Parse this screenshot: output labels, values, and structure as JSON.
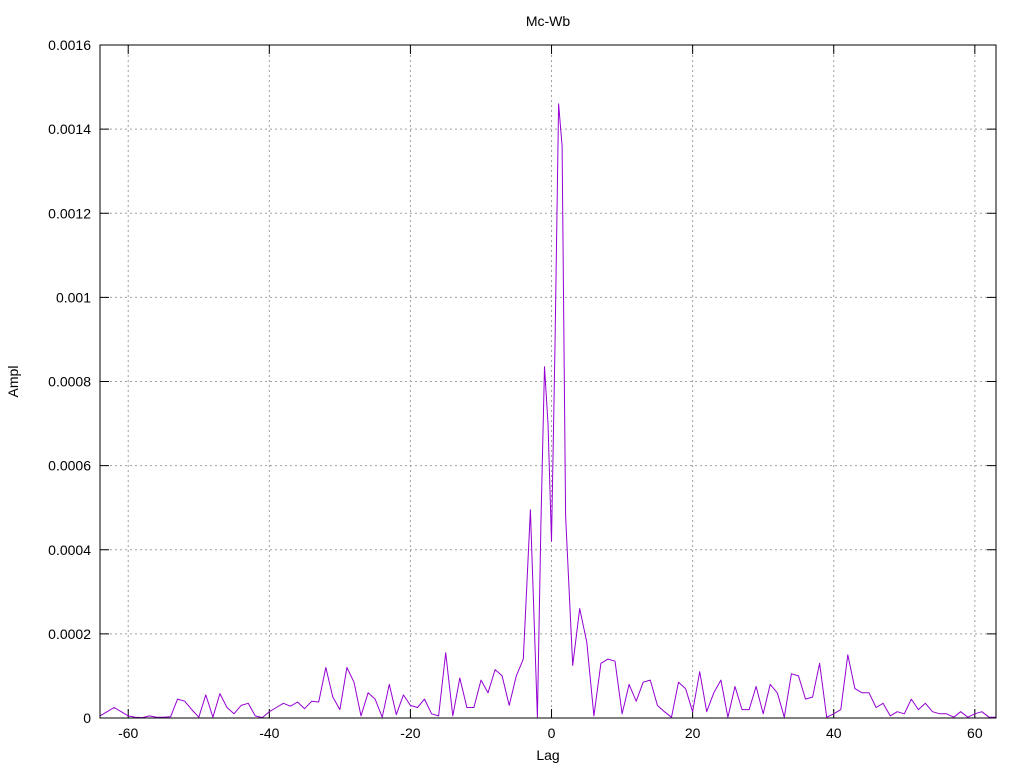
{
  "chart_data": {
    "type": "line",
    "title": "Mc-Wb",
    "xlabel": "Lag",
    "ylabel": "Ampl",
    "xlim": [
      -64,
      63
    ],
    "ylim": [
      0,
      0.0016
    ],
    "grid": true,
    "x_ticks": [
      -60,
      -40,
      -20,
      0,
      20,
      40,
      60
    ],
    "x_tick_labels": [
      "-60",
      "-40",
      "-20",
      "0",
      "20",
      "40",
      "60"
    ],
    "y_ticks": [
      0,
      0.0002,
      0.0004,
      0.0006,
      0.0008,
      0.001,
      0.0012,
      0.0014,
      0.0016
    ],
    "y_tick_labels": [
      "0",
      "0.0002",
      "0.0004",
      "0.0006",
      "0.0008",
      "0.001",
      "0.0012",
      "0.0014",
      "0.0016"
    ],
    "line_color": "#9400d3",
    "series": [
      {
        "x": [
          -64,
          -63,
          -62,
          -61,
          -60,
          -59,
          -58,
          -57,
          -56,
          -55,
          -54,
          -53,
          -52,
          -51,
          -50,
          -49,
          -48,
          -47,
          -46,
          -45,
          -44,
          -43,
          -42,
          -41,
          -40,
          -39,
          -38,
          -37,
          -36,
          -35,
          -34,
          -33,
          -32,
          -31,
          -30,
          -29,
          -28,
          -27,
          -26,
          -25,
          -24,
          -23,
          -22,
          -21,
          -20,
          -19,
          -18,
          -17,
          -16,
          -15,
          -14,
          -13,
          -12,
          -11,
          -10,
          -9,
          -8,
          -7,
          -6,
          -5,
          -4,
          -3,
          -2,
          -1.5,
          -1,
          -0.5,
          0,
          0.5,
          1,
          1.5,
          2,
          3,
          4,
          5,
          6,
          7,
          8,
          9,
          10,
          11,
          12,
          13,
          14,
          15,
          16,
          17,
          18,
          19,
          20,
          21,
          22,
          23,
          24,
          25,
          26,
          27,
          28,
          29,
          30,
          31,
          32,
          33,
          34,
          35,
          36,
          37,
          38,
          39,
          40,
          41,
          42,
          43,
          44,
          45,
          46,
          47,
          48,
          49,
          50,
          51,
          52,
          53,
          54,
          55,
          56,
          57,
          58,
          59,
          60,
          61,
          62,
          63
        ],
        "y": [
          5e-06,
          1.5e-05,
          2.5e-05,
          1.5e-05,
          5e-06,
          2e-06,
          1e-06,
          5e-06,
          2e-06,
          2e-06,
          3e-06,
          4.5e-05,
          4e-05,
          2e-05,
          2e-06,
          5.5e-05,
          2e-06,
          5.8e-05,
          2.5e-05,
          1e-05,
          3e-05,
          3.5e-05,
          5e-06,
          1e-06,
          1.5e-05,
          2.5e-05,
          3.5e-05,
          2.8e-05,
          3.8e-05,
          2.2e-05,
          4e-05,
          3.8e-05,
          0.00012,
          5e-05,
          2e-05,
          0.00012,
          8.5e-05,
          5e-06,
          6e-05,
          4.5e-05,
          2e-06,
          8e-05,
          8e-06,
          5.5e-05,
          3e-05,
          2.5e-05,
          4.5e-05,
          1e-05,
          5e-06,
          0.000155,
          5e-06,
          9.5e-05,
          2.5e-05,
          2.5e-05,
          9e-05,
          6e-05,
          0.000115,
          0.0001,
          3e-05,
          0.0001,
          0.00014,
          0.000495,
          2e-06,
          0.00046,
          0.000835,
          0.0007,
          0.00042,
          0.0009,
          0.00146,
          0.00136,
          0.00048,
          0.000125,
          0.00026,
          0.00018,
          5e-06,
          0.00013,
          0.00014,
          0.000135,
          1e-05,
          8e-05,
          4e-05,
          8.5e-05,
          9e-05,
          3e-05,
          1.5e-05,
          2e-06,
          8.5e-05,
          7e-05,
          1.5e-05,
          0.00011,
          1.5e-05,
          6e-05,
          9e-05,
          2e-06,
          7.5e-05,
          2e-05,
          2e-05,
          7.5e-05,
          1e-05,
          8e-05,
          6e-05,
          2e-06,
          0.000105,
          0.0001,
          4.5e-05,
          5e-05,
          0.00013,
          2e-06,
          1e-05,
          2e-05,
          0.00015,
          7e-05,
          6e-05,
          6e-05,
          2.5e-05,
          3.5e-05,
          5e-06,
          1.5e-05,
          1e-05,
          4.5e-05,
          2e-05,
          3.5e-05,
          1.5e-05,
          1e-05,
          1e-05,
          2e-06,
          1.5e-05,
          2e-06,
          1e-05,
          1.5e-05,
          2e-06,
          2e-06
        ]
      }
    ]
  }
}
